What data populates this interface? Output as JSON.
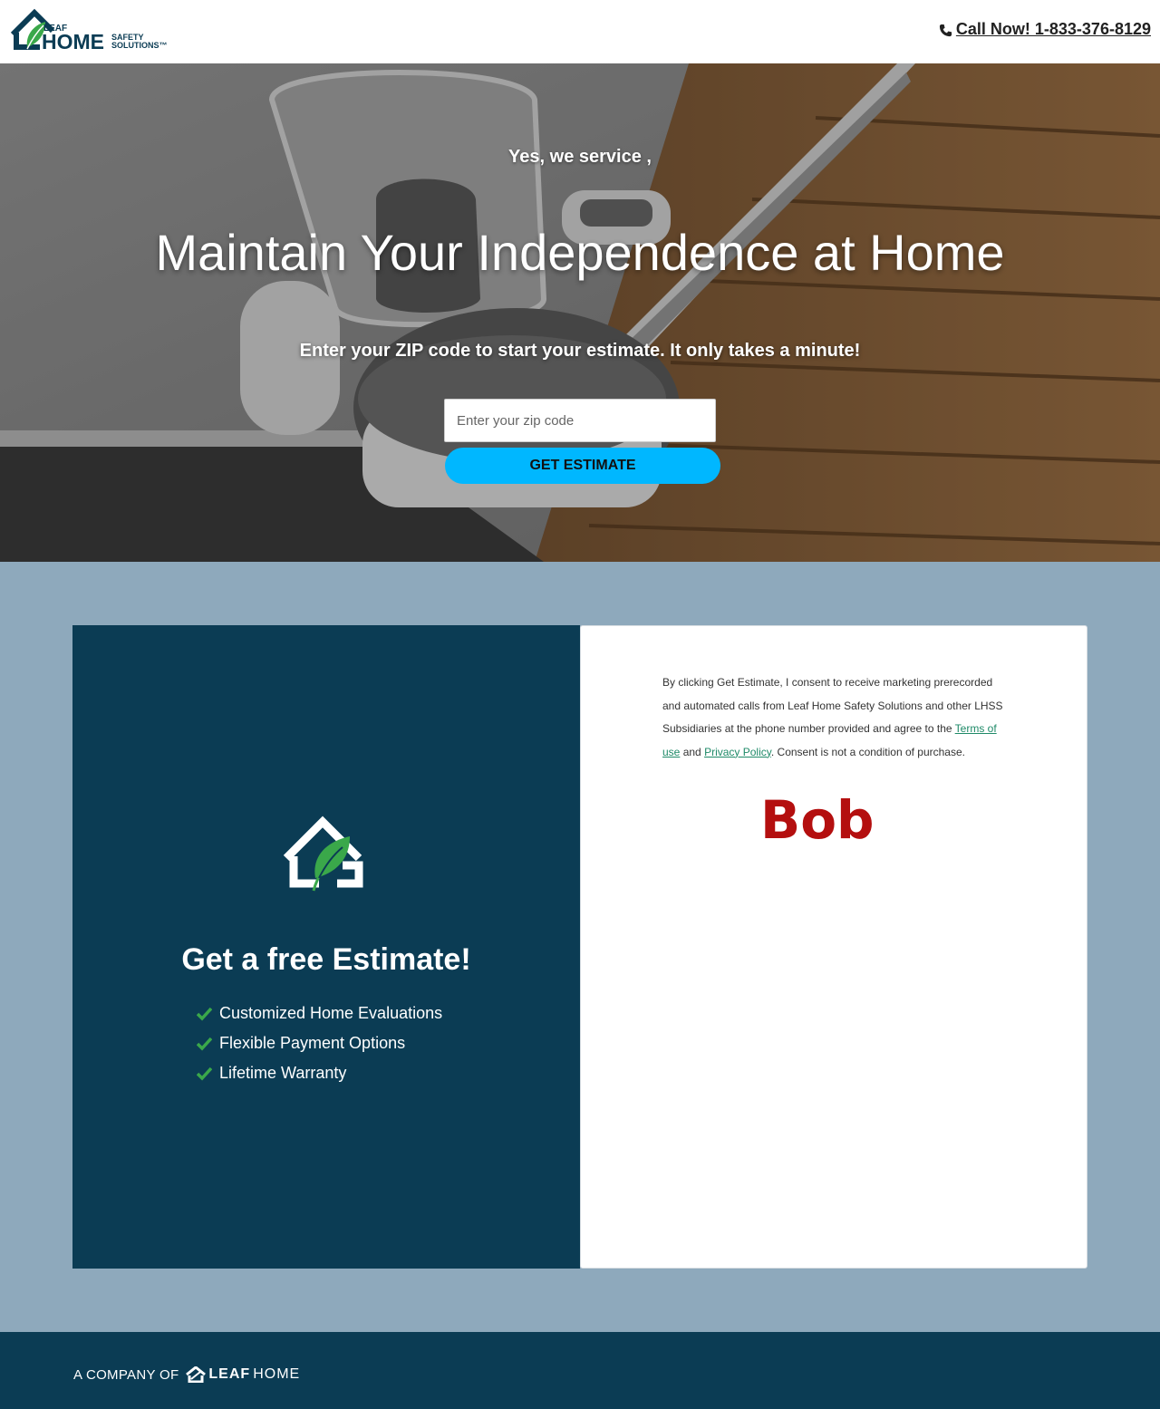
{
  "header": {
    "logo": {
      "line1": "LEAF",
      "line2": "HOME",
      "line3": "SAFETY",
      "line4": "SOLUTIONS™"
    },
    "phone_icon": "phone-icon",
    "call_label": "Call Now! 1-833-376-8129"
  },
  "hero": {
    "eyebrow": "Yes, we service ,",
    "title": "Maintain Your Independence at Home",
    "subtitle": "Enter your ZIP code to start your estimate. It only takes a minute!",
    "zip_placeholder": "Enter your zip code",
    "zip_value": "",
    "cta_label": "GET ESTIMATE"
  },
  "offer": {
    "icon": "house-leaf-icon",
    "title": "Get a free Estimate!",
    "benefits": [
      "Customized Home Evaluations",
      "Flexible Payment Options",
      "Lifetime Warranty"
    ]
  },
  "consent": {
    "text_before": "By clicking Get Estimate, I consent to receive marketing prerecorded and automated calls from Leaf Home Safety Solutions and other LHSS Subsidiaries at the phone number provided and agree to the ",
    "terms_link": "Terms of use",
    "text_middle": " and ",
    "privacy_link": "Privacy Policy",
    "text_after": ".  Consent is not a condition of purchase."
  },
  "overlay_name": "Bob",
  "footer": {
    "prefix": "A COMPANY OF",
    "brand_leaf": "LEAF",
    "brand_home": "HOME"
  },
  "colors": {
    "brand_navy": "#0b3c54",
    "accent_cyan": "#00b7ff",
    "section_bg": "#8ea9bc",
    "leaf_green": "#3aa84a",
    "link_green": "#1f8a68",
    "name_red": "#b40f0f"
  }
}
